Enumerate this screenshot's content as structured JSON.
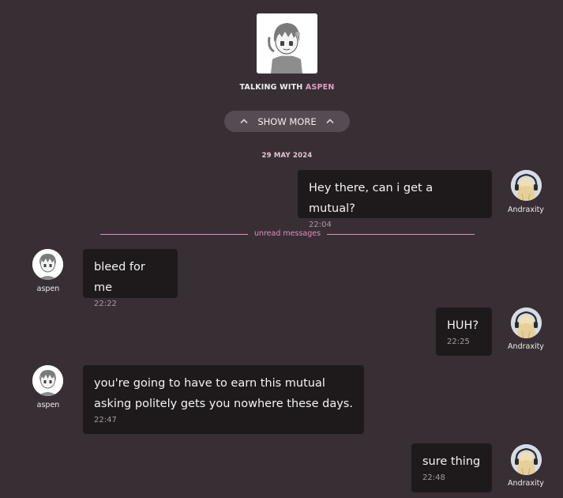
{
  "header": {
    "talking_prefix": "TALKING WITH",
    "contact_name": "ASPEN",
    "show_more_label": "SHOW MORE"
  },
  "date_separator": "29 MAY 2024",
  "unread_label": "unread messages",
  "colors": {
    "background": "#372f34",
    "bubble": "#1e1a1c",
    "accent": "#e79dc4",
    "pill": "#564b52"
  },
  "messages": [
    {
      "author": "Andraxity",
      "text": "Hey there, can i get a mutual?",
      "time": "22:04"
    },
    {
      "author": "aspen",
      "text": "bleed for me",
      "time": "22:22"
    },
    {
      "author": "Andraxity",
      "text": "HUH?",
      "time": "22:25"
    },
    {
      "author": "aspen",
      "text": "you're going to have to earn this mutual\nasking politely gets you nowhere these days.",
      "time": "22:47"
    },
    {
      "author": "Andraxity",
      "text": "sure thing",
      "time": "22:48"
    }
  ]
}
